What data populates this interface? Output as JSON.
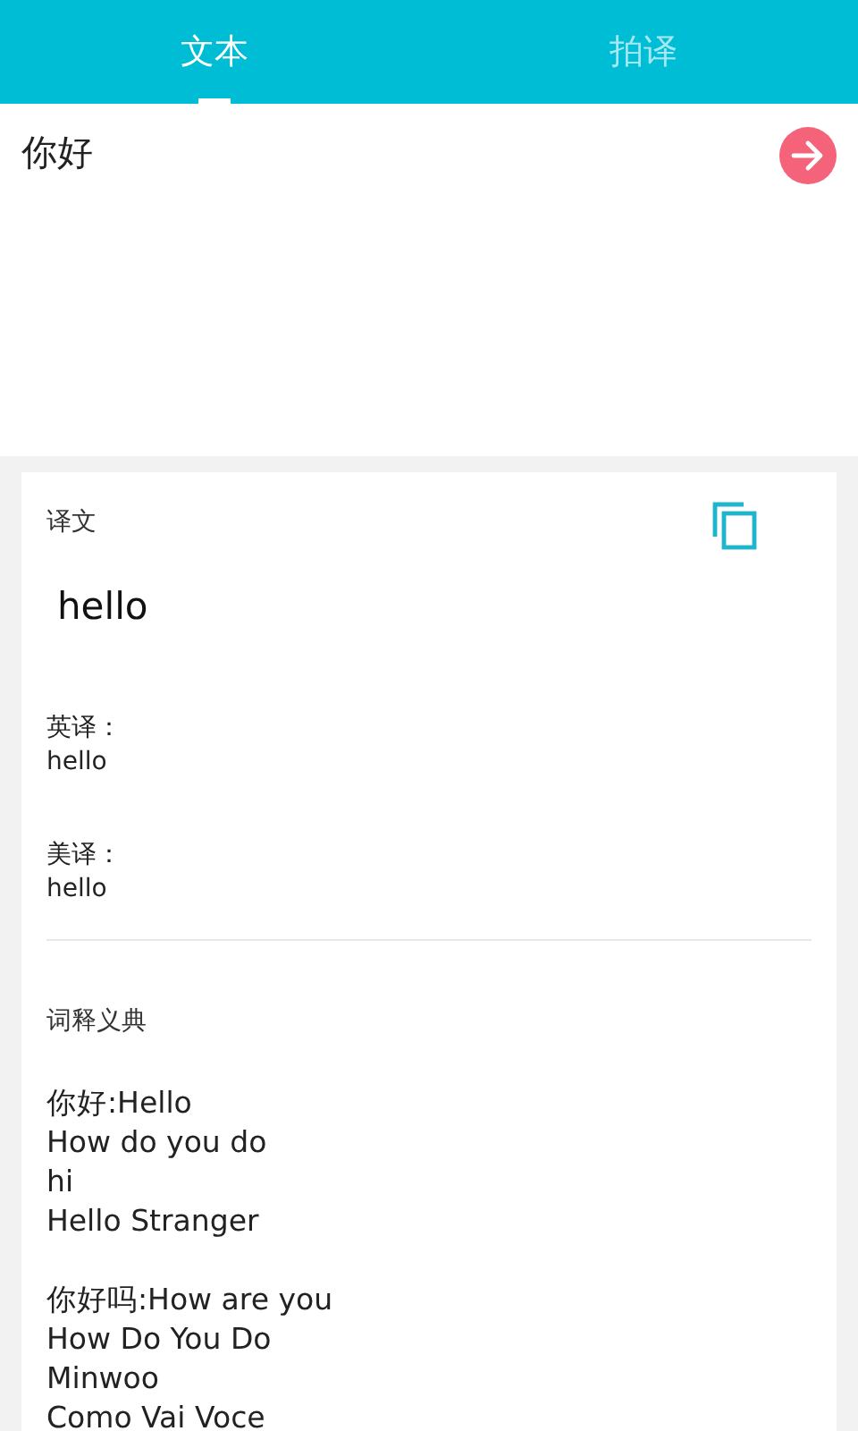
{
  "tabs": [
    {
      "label": "文本",
      "selected": true
    },
    {
      "label": "拍译",
      "selected": false
    }
  ],
  "input": {
    "value": "你好"
  },
  "result": {
    "heading": "译文",
    "translation": "hello",
    "phonetics": [
      {
        "label": "英译：",
        "value": "hello"
      },
      {
        "label": "美译：",
        "value": "hello"
      }
    ],
    "dictionary_heading": "词释义典",
    "dictionary": [
      {
        "lines": [
          "你好:Hello",
          "How do you do",
          "hi",
          "Hello Stranger"
        ]
      },
      {
        "lines": [
          "你好吗:How are you",
          "How Do You Do",
          "Minwoo",
          "Como Vai Voce"
        ]
      }
    ]
  }
}
